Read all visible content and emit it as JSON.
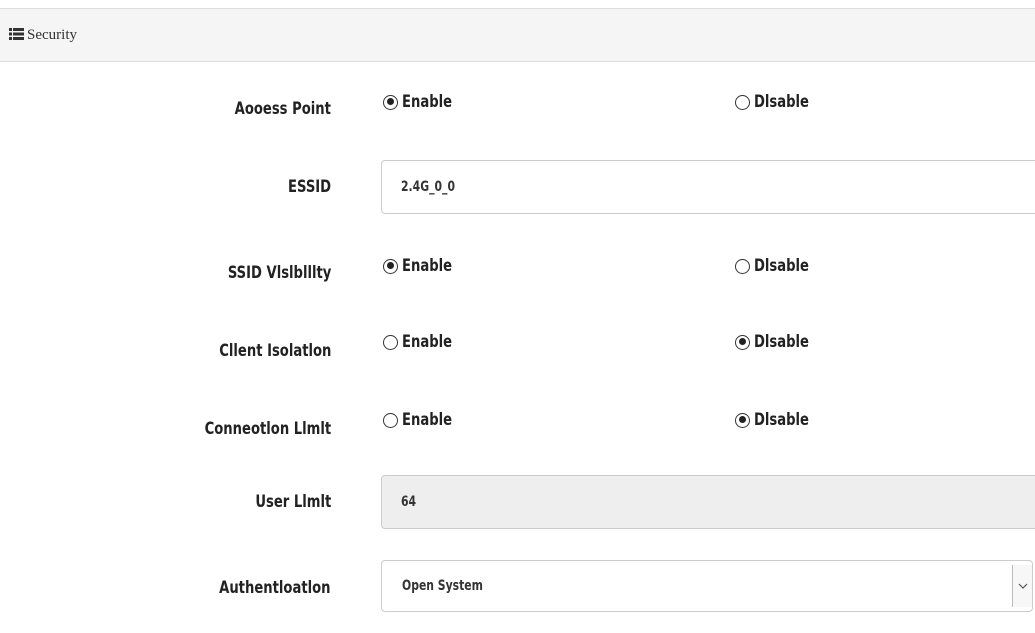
{
  "panel": {
    "title": "Security",
    "icon": "list-icon"
  },
  "access_point": {
    "label": "Aooess Point",
    "enable": "Enable",
    "disable": "Dlsable",
    "selected": "enable"
  },
  "essid": {
    "label": "ESSID",
    "value": "2.4G_0_0"
  },
  "ssid_visibility": {
    "label": "SSID Vlslblllty",
    "enable": "Enable",
    "disable": "Dlsable",
    "selected": "enable"
  },
  "client_isolation": {
    "label": "Cllent Isolatlon",
    "enable": "Enable",
    "disable": "Dlsable",
    "selected": "disable"
  },
  "connection_limit": {
    "label": "Conneotlon Llmlt",
    "enable": "Enable",
    "disable": "Dlsable",
    "selected": "disable"
  },
  "user_limit": {
    "label": "User Llmlt",
    "value": "64"
  },
  "authentication": {
    "label": "Authentloatlon",
    "value": "Open System"
  }
}
